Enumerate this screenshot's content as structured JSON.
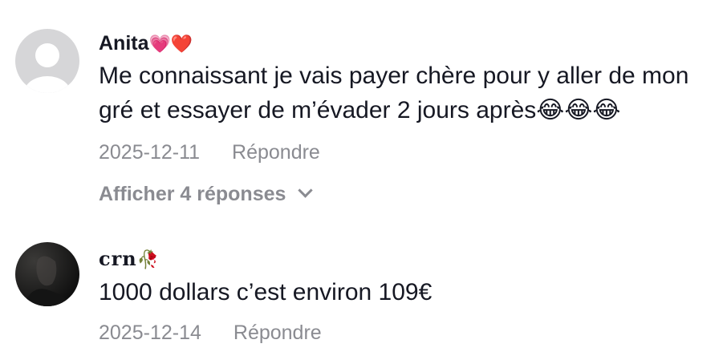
{
  "comments": [
    {
      "username": "Anita",
      "username_emoji": "💗❤️",
      "text": "Me connaissant je vais payer chère pour y aller de mon gré et essayer de m’évader 2 jours après😂😂😂",
      "date": "2025-12-11",
      "reply_label": "Répondre",
      "view_replies_label": "Afficher 4 réponses",
      "avatar": "default-user-icon"
    },
    {
      "username": "crn",
      "username_emoji": "🥀",
      "text": "1000 dollars c’est environ 109€",
      "date": "2025-12-14",
      "reply_label": "Répondre",
      "avatar": "dark-photo-avatar"
    }
  ],
  "colors": {
    "primary_text": "#161823",
    "secondary_text": "#8a8b91",
    "avatar_placeholder_bg": "#d6d6d8",
    "background": "#ffffff"
  }
}
